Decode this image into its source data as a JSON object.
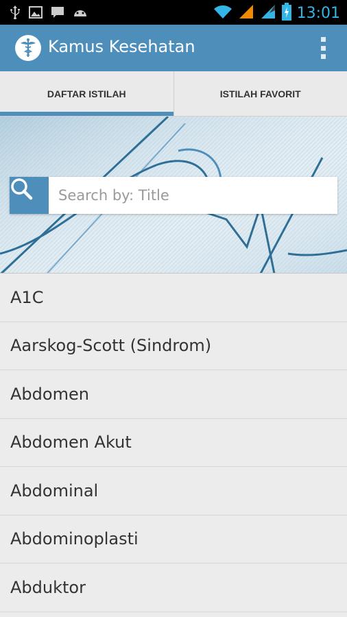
{
  "status_bar": {
    "time": "13:01",
    "icons": [
      "usb-icon",
      "image-icon",
      "chat-icon",
      "android-icon",
      "wifi-icon",
      "signal-icon",
      "signal-icon",
      "battery-charging-icon"
    ]
  },
  "app": {
    "title": "Kamus Kesehatan",
    "logo": "caduceus-icon",
    "colors": {
      "primary": "#4d8ebb",
      "accent": "#33b5e5"
    }
  },
  "tabs": [
    {
      "label": "DAFTAR ISTILAH",
      "active": true
    },
    {
      "label": "ISTILAH FAVORIT",
      "active": false
    }
  ],
  "search": {
    "placeholder": "Search by: Title",
    "value": ""
  },
  "terms": [
    "A1C",
    "Aarskog-Scott (Sindrom)",
    "Abdomen",
    "Abdomen Akut",
    "Abdominal",
    "Abdominoplasti",
    "Abduktor"
  ]
}
